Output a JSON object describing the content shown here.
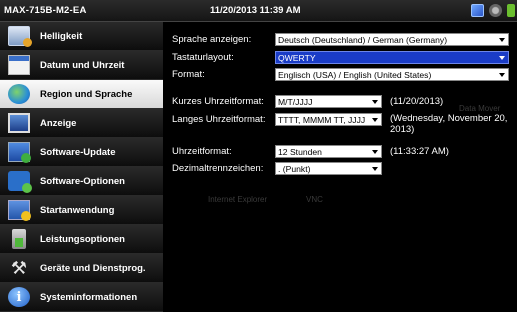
{
  "titlebar": {
    "device": "MAX-715B-M2-EA",
    "datetime": "11/20/2013 11:39 AM",
    "tray_icons": [
      "network-icon",
      "settings-icon",
      "battery-icon"
    ]
  },
  "sidebar": {
    "items": [
      {
        "label": "Helligkeit",
        "icon": "brightness-icon",
        "selected": false
      },
      {
        "label": "Datum und Uhrzeit",
        "icon": "calendar-icon",
        "selected": false
      },
      {
        "label": "Region und Sprache",
        "icon": "globe-icon",
        "selected": true
      },
      {
        "label": "Anzeige",
        "icon": "display-icon",
        "selected": false
      },
      {
        "label": "Software-Update",
        "icon": "update-icon",
        "selected": false
      },
      {
        "label": "Software-Optionen",
        "icon": "software-options-icon",
        "selected": false
      },
      {
        "label": "Startanwendung",
        "icon": "startup-app-icon",
        "selected": false
      },
      {
        "label": "Leistungsoptionen",
        "icon": "power-icon",
        "selected": false
      },
      {
        "label": "Geräte und Dienstprog.",
        "icon": "tools-icon",
        "selected": false
      },
      {
        "label": "Systeminformationen",
        "icon": "info-icon",
        "selected": false
      }
    ]
  },
  "form": {
    "display_language": {
      "label": "Sprache anzeigen:",
      "value": "Deutsch (Deutschland) / German (Germany)"
    },
    "keyboard_layout": {
      "label": "Tastaturlayout:",
      "value": "QWERTY"
    },
    "format": {
      "label": "Format:",
      "value": "Englisch (USA) / English (United States)"
    },
    "short_date": {
      "label": "Kurzes Uhrzeitformat:",
      "value": "M/T/JJJJ",
      "preview": "(11/20/2013)"
    },
    "long_date": {
      "label": "Langes Uhrzeitformat:",
      "value": "TTTT, MMMM TT, JJJJ",
      "preview": "(Wednesday, November 20, 2013)"
    },
    "time_format": {
      "label": "Uhrzeitformat:",
      "value": "12 Stunden",
      "preview": "(11:33:27 AM)"
    },
    "decimal_separator": {
      "label": "Dezimaltrennzeichen:",
      "value": ". (Punkt)"
    }
  },
  "background_ghost": {
    "browser": "Internet Explorer",
    "vnc": "VNC",
    "data_mover": "Data Mover"
  },
  "colors": {
    "highlight": "#1a3cc7",
    "selected_item": "#f0f0f0"
  }
}
